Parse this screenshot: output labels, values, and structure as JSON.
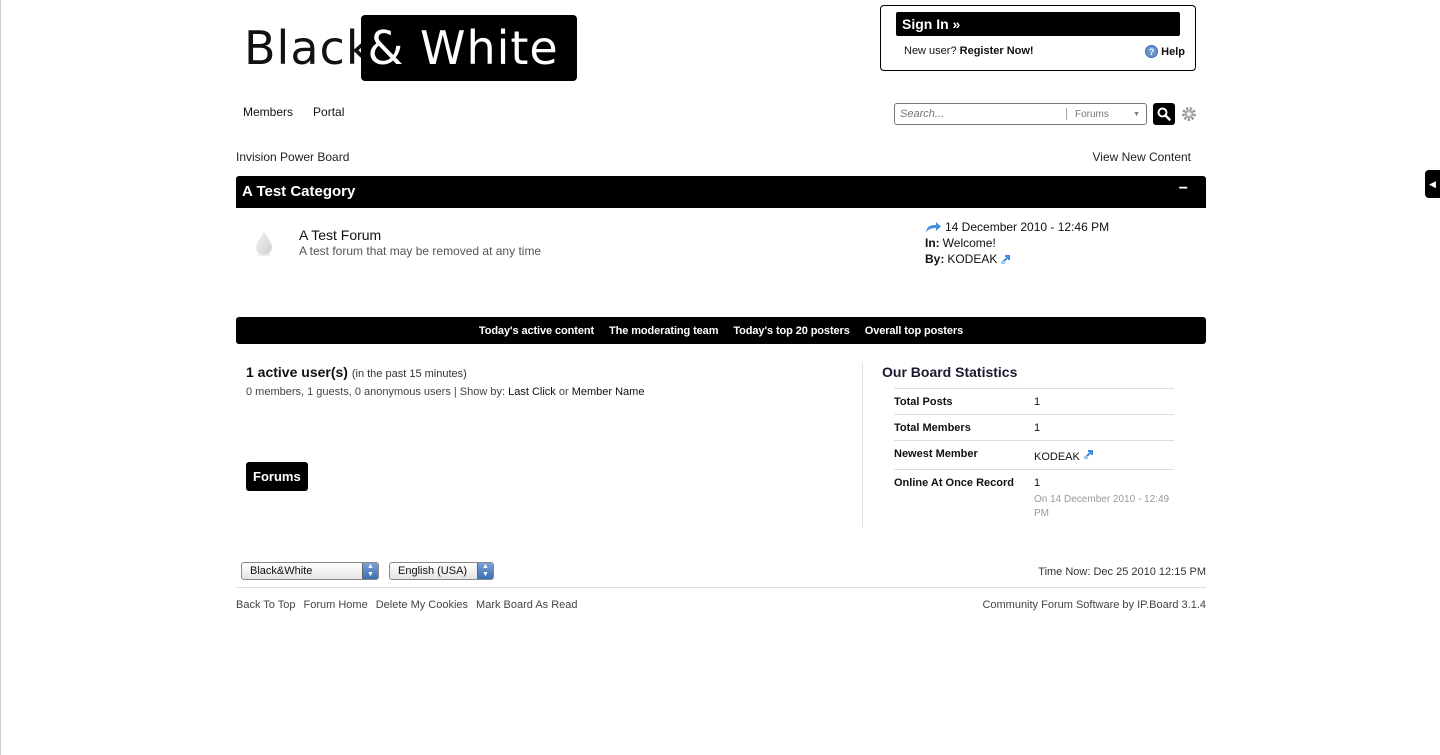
{
  "logo": {
    "black": "Black",
    "amp": "&",
    "white": "White"
  },
  "signin": {
    "button": "Sign In »",
    "new_user": "New user?",
    "register": "Register Now!",
    "help": "Help",
    "help_glyph": "?"
  },
  "nav": {
    "tabs": [
      "Forums",
      "Members",
      "Portal"
    ]
  },
  "search": {
    "placeholder": "Search...",
    "scope": "Forums"
  },
  "breadcrumb": "Invision Power Board",
  "view_new": "View New Content",
  "category": {
    "title": "A Test Category",
    "toggle": "−"
  },
  "forum": {
    "title": "A Test Forum",
    "desc": "A test forum that may be removed at any time",
    "last_date": "14 December 2010 - 12:46 PM",
    "in_label": "In:",
    "in_value": "Welcome!",
    "by_label": "By:",
    "by_value": "KODEAK"
  },
  "bar_links": [
    "Today's active content",
    "The moderating team",
    "Today's top 20 posters",
    "Overall top posters"
  ],
  "active_users": {
    "title": "1 active user(s)",
    "period": "(in the past 15 minutes)",
    "summary": "0 members, 1 guests, 0 anonymous users | Show by:",
    "opt1": "Last Click",
    "or": "or",
    "opt2": "Member Name"
  },
  "stats": {
    "title": "Our Board Statistics",
    "rows": [
      {
        "k": "Total Posts",
        "v": "1"
      },
      {
        "k": "Total Members",
        "v": "1"
      },
      {
        "k": "Newest Member",
        "v": "KODEAK"
      },
      {
        "k": "Online At Once Record",
        "v": "1",
        "note": "On 14 December 2010 - 12:49 PM"
      }
    ]
  },
  "footer": {
    "skin": "Black&White",
    "lang": "English (USA)",
    "time_now": "Time Now: Dec 25 2010 12:15 PM",
    "links": [
      "Back To Top",
      "Forum Home",
      "Delete My Cookies",
      "Mark Board As Read"
    ],
    "copyright": "Community Forum Software by IP.Board 3.1.4"
  },
  "colors": {
    "accent": "#000000",
    "link_icon": "#3a8ee6"
  }
}
